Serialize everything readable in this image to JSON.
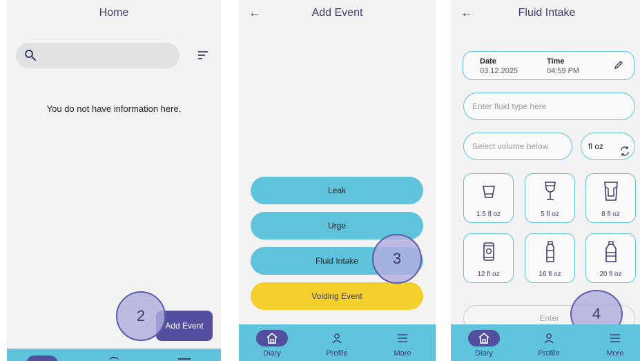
{
  "screen_home": {
    "title": "Home",
    "empty_message": "You do not have information here.",
    "add_event_button": "Add Event",
    "step_marker": "2"
  },
  "screen_add_event": {
    "back_icon": "arrow-left-icon",
    "title": "Add Event",
    "events": [
      "Leak",
      "Urge",
      "Fluid Intake",
      "Voiding Event"
    ],
    "step_marker": "3"
  },
  "screen_fluid_intake": {
    "back_icon": "arrow-left-icon",
    "title": "Fluid Intake",
    "date_label": "Date",
    "date_value": "03.12.2025",
    "time_label": "Time",
    "time_value": "04:59 PM",
    "fluid_type_placeholder": "Enter fluid type here",
    "volume_placeholder": "Select volume below",
    "unit": "fl oz",
    "volumes": [
      {
        "icon": "cup-icon",
        "label": "1.5 fl oz"
      },
      {
        "icon": "wine-glass-icon",
        "label": "5 fl oz"
      },
      {
        "icon": "glass-icon",
        "label": "8 fl oz"
      },
      {
        "icon": "can-icon",
        "label": "12 fl oz"
      },
      {
        "icon": "small-bottle-icon",
        "label": "16 fl oz"
      },
      {
        "icon": "large-bottle-icon",
        "label": "20 fl oz"
      }
    ],
    "enter_button": "Enter",
    "step_marker": "4"
  },
  "nav": {
    "diary": "Diary",
    "profile": "Profile",
    "more": "More"
  },
  "colors": {
    "accent": "#514f9e",
    "nav_bar": "#5fc3dc",
    "event_button": "#5fc3dc",
    "voiding_button": "#f4d02c",
    "text_dark": "#3d3c6b"
  }
}
